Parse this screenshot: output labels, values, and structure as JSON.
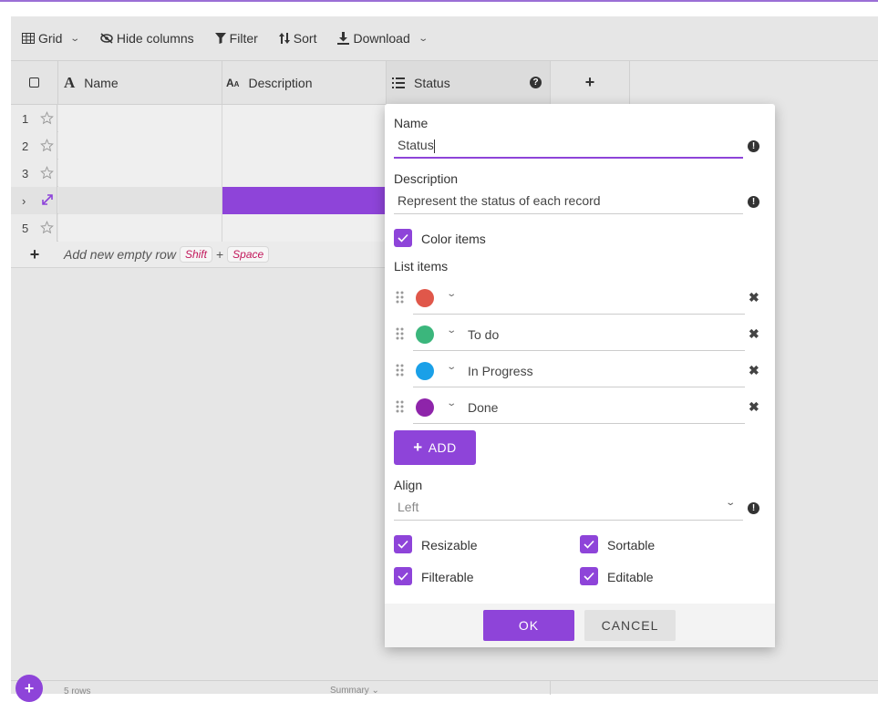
{
  "toolbar": {
    "grid_label": "Grid",
    "hide_columns_label": "Hide columns",
    "filter_label": "Filter",
    "sort_label": "Sort",
    "download_label": "Download"
  },
  "columns": {
    "name": "Name",
    "description": "Description",
    "status": "Status",
    "add": "+"
  },
  "rows": [
    {
      "num": "1"
    },
    {
      "num": "2"
    },
    {
      "num": "3"
    },
    {
      "num": "›"
    },
    {
      "num": "5"
    }
  ],
  "add_row": {
    "plus": "+",
    "label": "Add new empty row",
    "key1": "Shift",
    "plus_sep": "+",
    "key2": "Space"
  },
  "footer": {
    "rows_label": "5 rows",
    "summary_label": "Summary ⌄"
  },
  "colors": {
    "accent": "#8e44d9",
    "item_red": "#e0574a",
    "item_green": "#3bb67c",
    "item_blue": "#1aa0e8",
    "item_purple": "#8e24aa"
  },
  "dialog": {
    "name_label": "Name",
    "name_value": "Status",
    "description_label": "Description",
    "description_value": "Represent the status of each record",
    "color_items_label": "Color items",
    "list_items_label": "List items",
    "list_items": [
      {
        "text": "",
        "color": "#e0574a"
      },
      {
        "text": "To do",
        "color": "#3bb67c"
      },
      {
        "text": "In Progress",
        "color": "#1aa0e8"
      },
      {
        "text": "Done",
        "color": "#8e24aa"
      }
    ],
    "add_button": "ADD",
    "align_label": "Align",
    "align_value": "Left",
    "resizable_label": "Resizable",
    "sortable_label": "Sortable",
    "filterable_label": "Filterable",
    "editable_label": "Editable",
    "ok_button": "OK",
    "cancel_button": "CANCEL"
  }
}
